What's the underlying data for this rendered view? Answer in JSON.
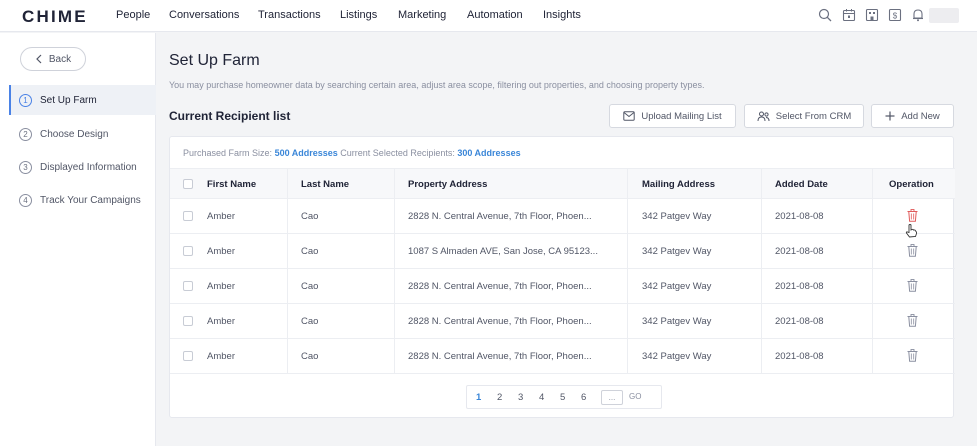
{
  "brand": {
    "logo": "CHIME"
  },
  "nav": {
    "items": [
      "People",
      "Conversations",
      "Transactions",
      "Listings",
      "Marketing",
      "Automation",
      "Insights"
    ]
  },
  "top_icons": [
    "search-icon",
    "calendar-icon",
    "building-icon",
    "dollar-icon",
    "bell-icon"
  ],
  "sidebar": {
    "back_label": "Back",
    "steps": [
      {
        "num": "1",
        "label": "Set Up Farm",
        "active": true
      },
      {
        "num": "2",
        "label": "Choose Design",
        "active": false
      },
      {
        "num": "3",
        "label": "Displayed Information",
        "active": false
      },
      {
        "num": "4",
        "label": "Track Your Campaigns",
        "active": false
      }
    ]
  },
  "main": {
    "title": "Set Up Farm",
    "subtitle": "You may purchase homeowner data by searching certain area, adjust area scope, filtering out properties, and choosing property types.",
    "section_title": "Current Recipient list",
    "actions": {
      "upload": "Upload Mailing List",
      "select_crm": "Select From CRM",
      "add_new": "Add New"
    },
    "summary": {
      "purchased_label": "Purchased Farm Size:",
      "purchased_value": "500 Addresses",
      "selected_label": "Current Selected Recipients:",
      "selected_value": "300 Addresses"
    },
    "table": {
      "headers": {
        "first_name": "First Name",
        "last_name": "Last Name",
        "property_address": "Property Address",
        "mailing_address": "Mailing Address",
        "added_date": "Added Date",
        "operation": "Operation"
      },
      "rows": [
        {
          "first": "Amber",
          "last": "Cao",
          "property": "2828 N. Central Avenue, 7th Floor, Phoen...",
          "mailing": "342 Patgev Way",
          "date": "2021-08-08"
        },
        {
          "first": "Amber",
          "last": "Cao",
          "property": "1087 S Almaden AVE, San Jose, CA 95123...",
          "mailing": "342 Patgev Way",
          "date": "2021-08-08"
        },
        {
          "first": "Amber",
          "last": "Cao",
          "property": "2828 N. Central Avenue, 7th Floor, Phoen...",
          "mailing": "342 Patgev Way",
          "date": "2021-08-08"
        },
        {
          "first": "Amber",
          "last": "Cao",
          "property": "2828 N. Central Avenue, 7th Floor, Phoen...",
          "mailing": "342 Patgev Way",
          "date": "2021-08-08"
        },
        {
          "first": "Amber",
          "last": "Cao",
          "property": "2828 N. Central Avenue, 7th Floor, Phoen...",
          "mailing": "342 Patgev Way",
          "date": "2021-08-08"
        }
      ]
    },
    "pagination": {
      "pages": [
        "1",
        "2",
        "3",
        "4",
        "5",
        "6"
      ],
      "current": "1",
      "ellipsis": "...",
      "go": "GO"
    }
  },
  "colors": {
    "accent": "#3a86d8",
    "active_step": "#4a82e6",
    "delete_hover": "#e05a5a"
  }
}
